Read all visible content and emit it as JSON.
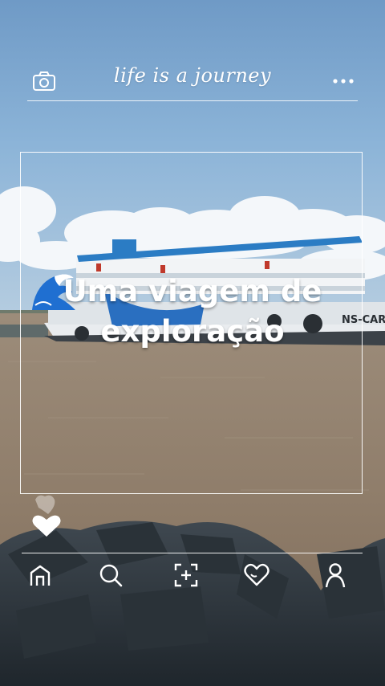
{
  "header": {
    "tagline": "life is a journey",
    "left_icon": "camera-icon",
    "right_icon": "more-dots-icon"
  },
  "caption": {
    "line1": "Uma viagem de",
    "line2": "exploração",
    "emoji_icon": "water-wave-icon"
  },
  "boat": {
    "hull_text": "NS-CAR"
  },
  "decor": {
    "heart_icon": "heart-bubble-icon"
  },
  "bottom_nav": {
    "items": [
      {
        "icon": "home-icon"
      },
      {
        "icon": "search-icon"
      },
      {
        "icon": "add-icon"
      },
      {
        "icon": "heart-icon"
      },
      {
        "icon": "profile-icon"
      }
    ]
  },
  "colors": {
    "sky": "#7fa6cc",
    "river": "#8c7a68",
    "overlay": "#ffffff",
    "boat_trim": "#2b7cc4"
  }
}
